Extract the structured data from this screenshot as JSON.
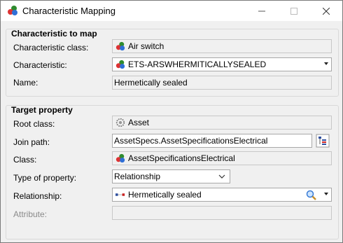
{
  "window": {
    "title": "Characteristic Mapping"
  },
  "characteristic_group": {
    "title": "Characteristic to map",
    "class_label": "Characteristic class:",
    "class_value": "Air switch",
    "characteristic_label": "Characteristic:",
    "characteristic_value": "ETS-ARSWHERMITICALLYSEALED",
    "name_label": "Name:",
    "name_value": "Hermetically sealed"
  },
  "target_group": {
    "title": "Target property",
    "root_class_label": "Root class:",
    "root_class_value": "Asset",
    "join_path_label": "Join path:",
    "join_path_value": "AssetSpecs.AssetSpecificationsElectrical",
    "class_label": "Class:",
    "class_value": "AssetSpecificationsElectrical",
    "type_label": "Type of property:",
    "type_value": "Relationship",
    "relationship_label": "Relationship:",
    "relationship_value": "Hermetically sealed",
    "attribute_label": "Attribute:",
    "attribute_value": ""
  },
  "icons": {
    "app": "class-balls-icon",
    "class": "class-balls-icon",
    "root": "gear-cog-icon",
    "join_picker": "tree-picker-icon",
    "relationship": "relationship-arrow-icon",
    "search": "magnifier-icon"
  },
  "colors": {
    "frame": "#f0f0f0",
    "border": "#d9d9d9",
    "disabled_text": "#8a8a8a"
  }
}
